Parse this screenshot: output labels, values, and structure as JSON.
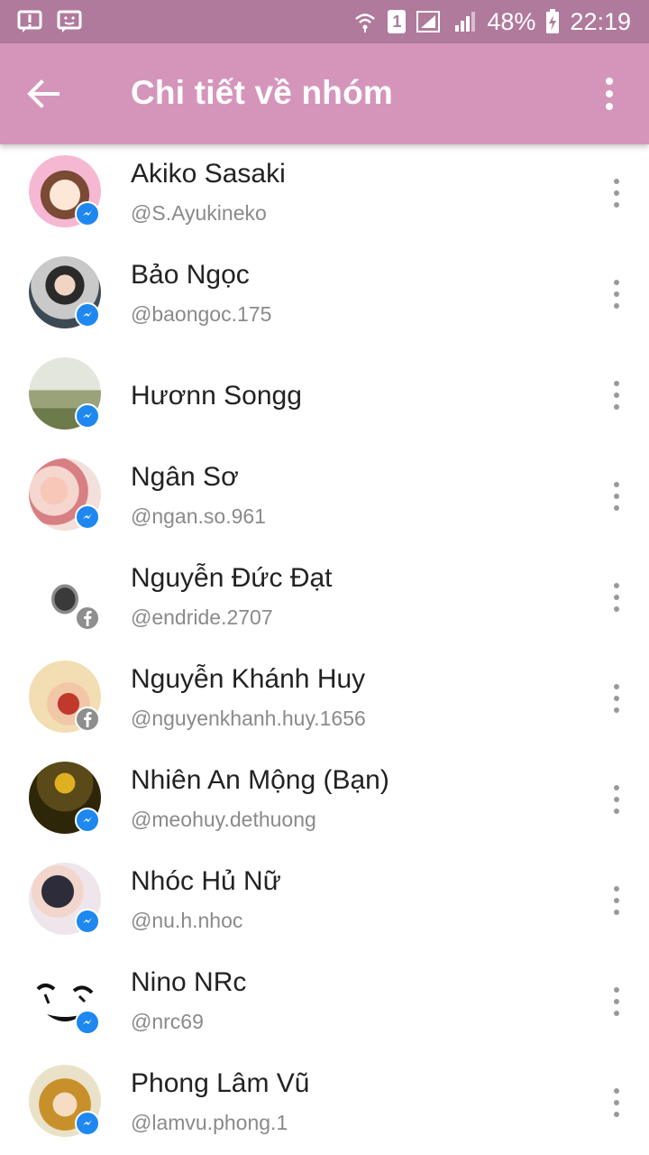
{
  "status_bar": {
    "battery": "48%",
    "time": "22:19",
    "sim": "1",
    "icons": [
      "alert-icon",
      "face-icon",
      "wifi-icon",
      "sim-icon",
      "signal-icon",
      "signal-icon",
      "battery-icon"
    ]
  },
  "app_bar": {
    "title": "Chi tiết về nhóm",
    "back_icon": "arrow-left-icon",
    "menu_icon": "more-vertical-icon",
    "background": "#d595bb",
    "status_background": "#b07a9c"
  },
  "members": [
    {
      "name": "Akiko Sasaki",
      "handle": "@S.Ayukineko",
      "badge": "messenger",
      "avatar_colors": [
        "#f6b7d2",
        "#7a4a35"
      ]
    },
    {
      "name": "Bảo Ngọc",
      "handle": "@baongoc.175",
      "badge": "messenger",
      "avatar_colors": [
        "#d9d9d9",
        "#2a2a2a"
      ]
    },
    {
      "name": "Hươnn Songg",
      "handle": "",
      "badge": "messenger",
      "avatar_colors": [
        "#c7ccb4",
        "#6d7a4a"
      ]
    },
    {
      "name": "Ngân Sơ",
      "handle": "@ngan.so.961",
      "badge": "messenger",
      "avatar_colors": [
        "#f5d7cf",
        "#d77f83"
      ]
    },
    {
      "name": "Nguyễn Đức Đạt",
      "handle": "@endride.2707",
      "badge": "facebook",
      "avatar_colors": [
        "#ffffff",
        "#3a3a3a"
      ]
    },
    {
      "name": "Nguyễn Khánh Huy",
      "handle": "@nguyenkhanh.huy.1656",
      "badge": "facebook",
      "avatar_colors": [
        "#f3ddb2",
        "#c0392b"
      ]
    },
    {
      "name": "Nhiên An Mộng (Bạn)",
      "handle": "@meohuy.dethuong",
      "badge": "messenger",
      "avatar_colors": [
        "#5a4a1a",
        "#e0b020"
      ]
    },
    {
      "name": "Nhóc Hủ Nữ",
      "handle": "@nu.h.nhoc",
      "badge": "messenger",
      "avatar_colors": [
        "#eee6ea",
        "#2c2c3a"
      ]
    },
    {
      "name": "Nino NRc",
      "handle": "@nrc69",
      "badge": "messenger",
      "avatar_colors": [
        "#ffffff",
        "#111111"
      ]
    },
    {
      "name": "Phong Lâm Vũ",
      "handle": "@lamvu.phong.1",
      "badge": "messenger",
      "avatar_colors": [
        "#e9e2c8",
        "#c8902a"
      ]
    }
  ]
}
